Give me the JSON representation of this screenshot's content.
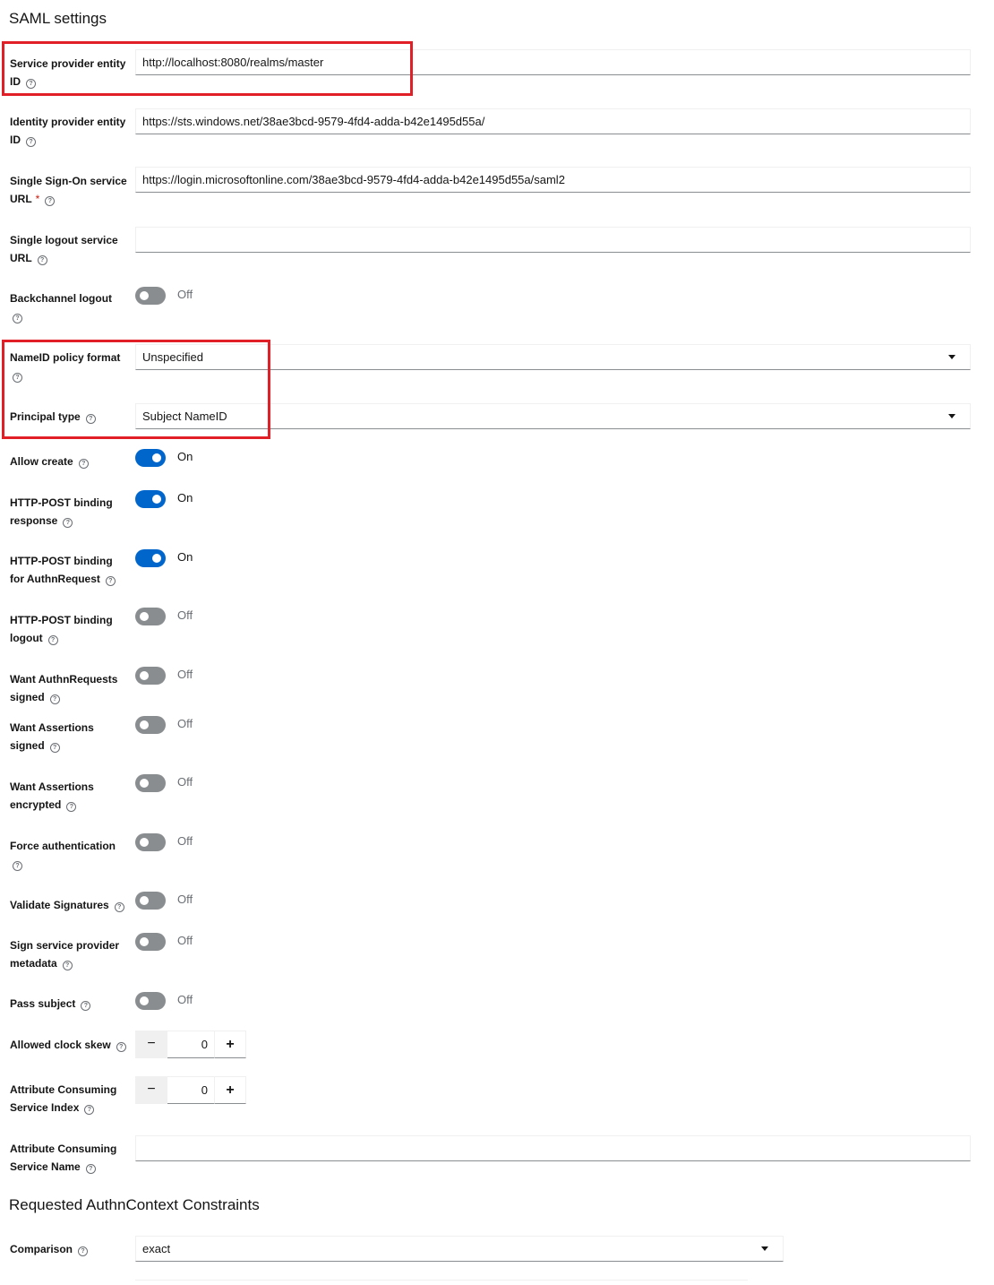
{
  "saml_settings": {
    "title": "SAML settings",
    "sp_entity_id": {
      "label": "Service provider entity ID",
      "value": "http://localhost:8080/realms/master"
    },
    "idp_entity_id": {
      "label": "Identity provider entity ID",
      "value": "https://sts.windows.net/38ae3bcd-9579-4fd4-adda-b42e1495d55a/"
    },
    "sso_url": {
      "label": "Single Sign-On service URL",
      "required_marker": "*",
      "value": "https://login.microsoftonline.com/38ae3bcd-9579-4fd4-adda-b42e1495d55a/saml2"
    },
    "slo_url": {
      "label": "Single logout service URL",
      "value": ""
    },
    "backchannel_logout": {
      "label": "Backchannel logout",
      "state": "Off"
    },
    "nameid_policy_format": {
      "label": "NameID policy format",
      "value": "Unspecified"
    },
    "principal_type": {
      "label": "Principal type",
      "value": "Subject NameID"
    },
    "allow_create": {
      "label": "Allow create",
      "state": "On"
    },
    "http_post_binding_response": {
      "label": "HTTP-POST binding response",
      "state": "On"
    },
    "http_post_binding_authn": {
      "label": "HTTP-POST binding for AuthnRequest",
      "state": "On"
    },
    "http_post_binding_logout": {
      "label": "HTTP-POST binding logout",
      "state": "Off"
    },
    "want_authn_signed": {
      "label": "Want AuthnRequests signed",
      "state": "Off"
    },
    "want_assertions_signed": {
      "label": "Want Assertions signed",
      "state": "Off"
    },
    "want_assertions_encrypted": {
      "label": "Want Assertions encrypted",
      "state": "Off"
    },
    "force_authentication": {
      "label": "Force authentication",
      "state": "Off"
    },
    "validate_signatures": {
      "label": "Validate Signatures",
      "state": "Off"
    },
    "sign_sp_metadata": {
      "label": "Sign service provider metadata",
      "state": "Off"
    },
    "pass_subject": {
      "label": "Pass subject",
      "state": "Off"
    },
    "allowed_clock_skew": {
      "label": "Allowed clock skew",
      "value": "0",
      "minus": "−",
      "plus": "+"
    },
    "attr_consuming_index": {
      "label": "Attribute Consuming Service Index",
      "value": "0",
      "minus": "−",
      "plus": "+"
    },
    "attr_consuming_name": {
      "label": "Attribute Consuming Service Name",
      "value": ""
    }
  },
  "authn_context": {
    "title": "Requested AuthnContext Constraints",
    "comparison": {
      "label": "Comparison",
      "value": "exact"
    }
  },
  "icons": {
    "help": "?"
  },
  "colors": {
    "toggle_on": "#0066cc",
    "toggle_off": "#8a8d90",
    "highlight": "#e01f26",
    "required": "#c9190b"
  }
}
